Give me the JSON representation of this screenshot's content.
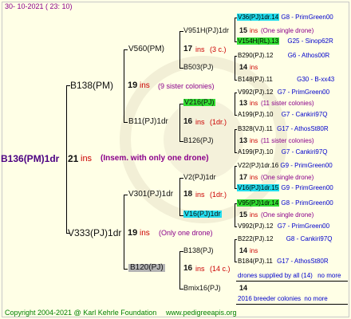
{
  "header": "30- 10-2021 ( 23: 10)",
  "footer": {
    "copyright": "Copyright 2004-2021 @ Karl Kehrle Foundation",
    "site": "www.pedigreeapis.org"
  },
  "root": {
    "name": "B136(PM)1dr",
    "num": "21",
    "ins": "ins",
    "note": "(Insem. with only one drone)"
  },
  "gen1": [
    {
      "name": "B138(PM)",
      "num": "19",
      "ins": "ins",
      "note": "(9 sister colonies)"
    },
    {
      "name": "V333(PJ)1dr",
      "num": "19",
      "ins": "ins",
      "note": "(Only one drone)"
    }
  ],
  "gen2": [
    {
      "name": "V560(PM)",
      "num": "17",
      "ins": "ins",
      "note": "(3 c.)"
    },
    {
      "name": "B11(PJ)1dr",
      "num": "16",
      "ins": "ins",
      "note": "(1dr.)"
    },
    {
      "name": "V301(PJ)1dr",
      "num": "18",
      "ins": "ins",
      "note": "(1dr.)"
    },
    {
      "name": "B120(PJ)",
      "num": "16",
      "ins": "ins",
      "note": "(14 c.)"
    }
  ],
  "gen3": [
    {
      "name": "V951H(PJ)1dr",
      "num": "15",
      "ins": "ins",
      "note": "(One single drone)"
    },
    {
      "name": "B503(PJ)",
      "num": "14",
      "ins": "ins",
      "note": ""
    },
    {
      "name": "V216(PJ)",
      "num": "13",
      "ins": "ins",
      "note": "(11 sister colonies)"
    },
    {
      "name": "B126(PJ)",
      "num": "13",
      "ins": "ins",
      "note": "(11 sister colonies)"
    },
    {
      "name": "V2(PJ)1dr",
      "num": "17",
      "ins": "ins",
      "note": "(One single drone)"
    },
    {
      "name": "V16(PJ)1dr",
      "num": "15",
      "ins": "ins",
      "note": "(One single drone)"
    },
    {
      "name": "B138(PJ)",
      "num": "14",
      "ins": "ins",
      "note": ""
    },
    {
      "name": "Bmix16(PJ)",
      "num": "14",
      "ins": "",
      "note": ""
    }
  ],
  "gen4": [
    {
      "name": "V36(PJ)1dr.14",
      "tag": "G8 - PrimGreen00"
    },
    {
      "name": "V154H(RL).13",
      "tag": "G25 - Sinop62R"
    },
    {
      "name": "B290(PJ).12",
      "tag": "G6 - Athos00R"
    },
    {
      "name": "B148(PJ).11",
      "tag": "G30 - B-xx43"
    },
    {
      "name": "V992(PJ).12",
      "tag": "G7 - PrimGreen00"
    },
    {
      "name": "A199(PJ).10",
      "tag": "G7 - Cankiri97Q"
    },
    {
      "name": "B328(VJ).11",
      "tag": "G17 - AthosSt80R"
    },
    {
      "name": "A199(PJ).10",
      "tag": "G7 - Cankiri97Q"
    },
    {
      "name": "V22(PJ)1dr.16",
      "tag": "G9 - PrimGreen00"
    },
    {
      "name": "V16(PJ)1dr.15",
      "tag": "G9 - PrimGreen00"
    },
    {
      "name": "V95(PJ)1dr.14",
      "tag": "G8 - PrimGreen00"
    },
    {
      "name": "V992(PJ).12",
      "tag": "G7 - PrimGreen00"
    },
    {
      "name": "B222(PJ).12",
      "tag": "G8 - Cankiri97Q"
    },
    {
      "name": "B184(PJ).11",
      "tag": "G17 - AthosSt80R"
    }
  ],
  "drones_note": "drones supplied by all (14)",
  "drones_more": "no more",
  "colonies_note": "2016 breeder colonies",
  "colonies_more": "no more"
}
